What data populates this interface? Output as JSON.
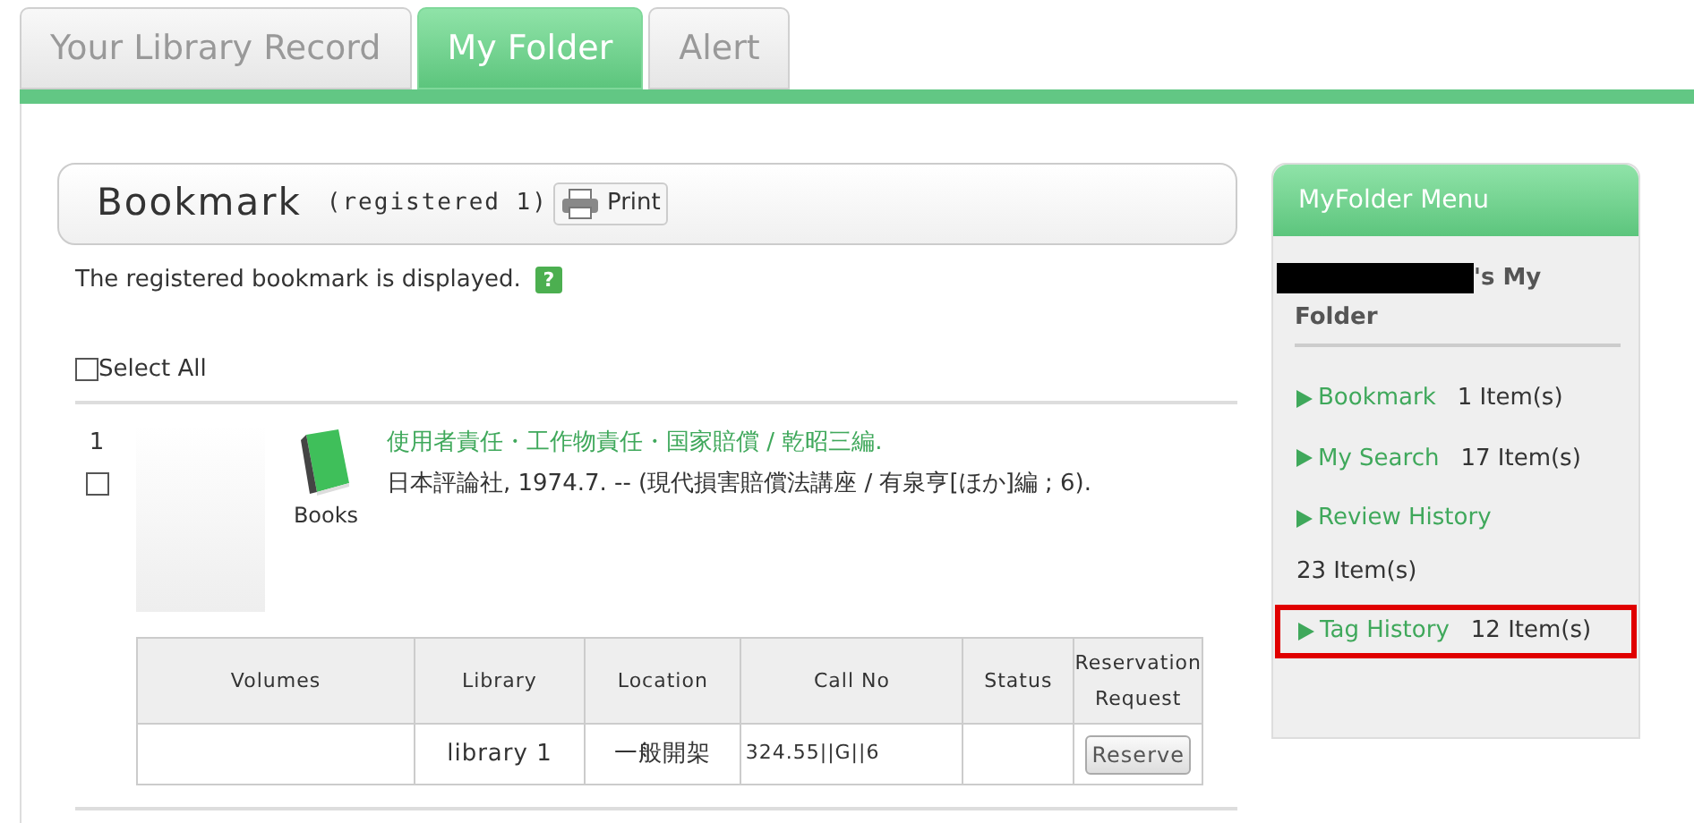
{
  "tabs": [
    {
      "label": "Your Library Record",
      "selected": false
    },
    {
      "label": "My Folder",
      "selected": true
    },
    {
      "label": "Alert",
      "selected": false
    }
  ],
  "bookmark": {
    "title": "Bookmark",
    "count": "(registered 1)",
    "print_button": "Print",
    "description": "The registered bookmark is displayed.",
    "help_icon": "?",
    "select_all": {
      "label": "Select All",
      "checked": false
    }
  },
  "records": [
    {
      "number": "1",
      "checked": false,
      "type_label": "Books",
      "title": "使用者責任・工作物責任・国家賠償 / 乾昭三編.",
      "details": "日本評論社, 1974.7. -- (現代損害賠償法講座 / 有泉亨[ほか]編 ; 6).",
      "holdings": {
        "columns": [
          "Volumes",
          "Library",
          "Location",
          "Call No",
          "Status",
          "Reservation Request"
        ],
        "rows": [
          {
            "volumes": "",
            "library": "library 1",
            "location": "一般開架",
            "call_no": "324.55||G||6",
            "status": "",
            "button": "Reserve"
          }
        ]
      }
    }
  ],
  "sidebar": {
    "title": "MyFolder Menu",
    "owner_suffix": "'s My",
    "owner_line2": "Folder",
    "items": [
      {
        "label": "Bookmark",
        "count": "1 Item(s)",
        "highlighted": false
      },
      {
        "label": "My Search",
        "count": "17 Item(s)",
        "highlighted": false
      },
      {
        "label": "Review History",
        "count": "23 Item(s)",
        "highlighted": false
      },
      {
        "label": "Tag History",
        "count": "12 Item(s)",
        "highlighted": true
      }
    ]
  }
}
